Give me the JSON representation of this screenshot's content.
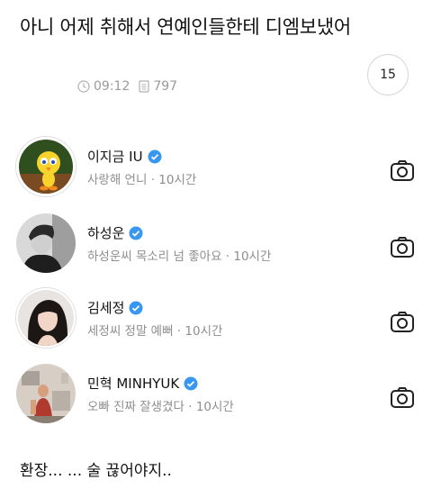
{
  "post": {
    "title": "아니 어제 취해서 연예인들한테 디엠보냈어",
    "time": "09:12",
    "views": "797",
    "comment_count": "15",
    "footer_text": "환장... ... 술 끊어야지.."
  },
  "accent_color": "#3897f0",
  "messages": [
    {
      "name": "이지금 IU",
      "text": "사랑해 언니",
      "time": "10시간",
      "verified": true,
      "avatar": "tweety-bird"
    },
    {
      "name": "하성운",
      "text": "하성운씨 목소리 넘 좋아요",
      "time": "10시간",
      "verified": true,
      "avatar": "person-bw"
    },
    {
      "name": "김세정",
      "text": "세정씨 정말 예뻐",
      "time": "10시간",
      "verified": true,
      "avatar": "person-dark-hair"
    },
    {
      "name": "민혁 MINHYUK",
      "text": "오빠 진짜 잘생겼다",
      "time": "10시간",
      "verified": true,
      "avatar": "person-room"
    }
  ],
  "separator": " · "
}
